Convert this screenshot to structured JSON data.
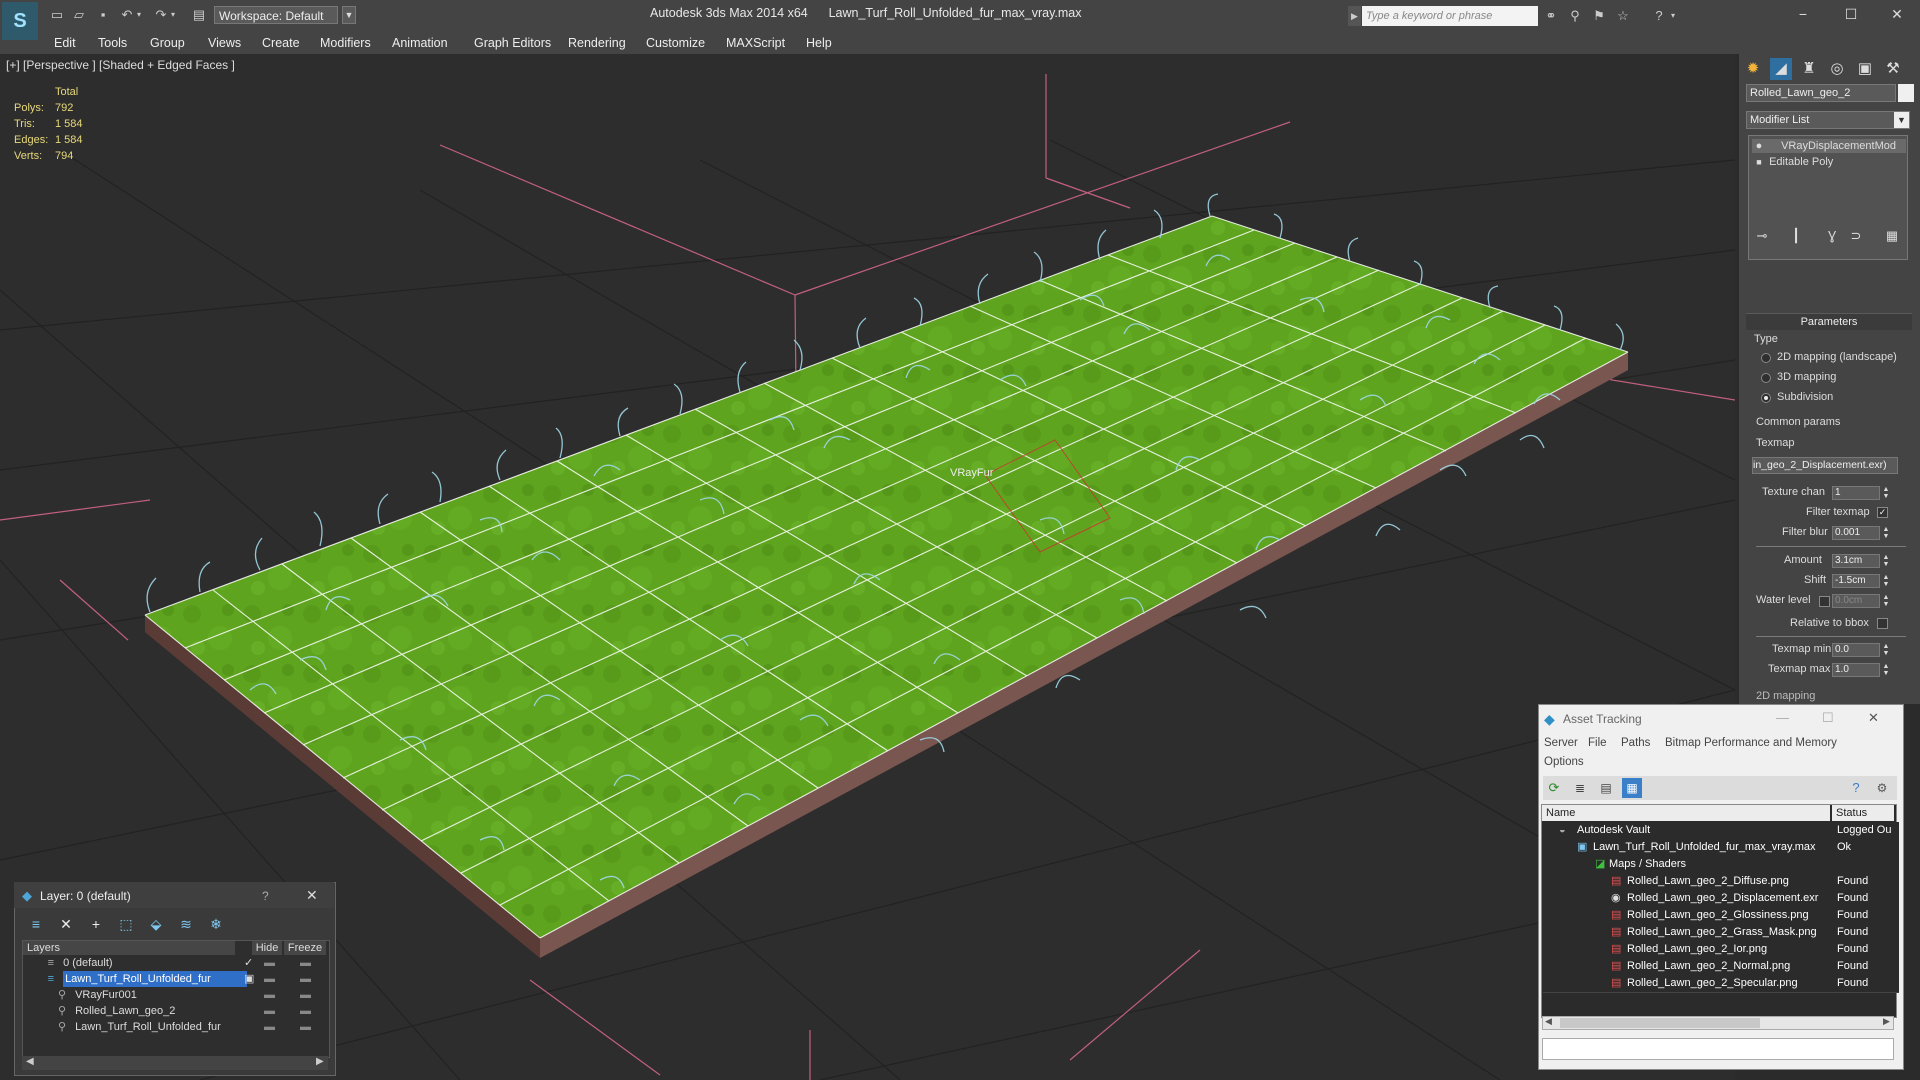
{
  "titlebar": {
    "workspace": "Workspace: Default",
    "app_name": "Autodesk 3ds Max  2014 x64",
    "file_name": "Lawn_Turf_Roll_Unfolded_fur_max_vray.max",
    "search_placeholder": "Type a keyword or phrase"
  },
  "menu": [
    "Edit",
    "Tools",
    "Group",
    "Views",
    "Create",
    "Modifiers",
    "Animation",
    "Graph Editors",
    "Rendering",
    "Customize",
    "MAXScript",
    "Help"
  ],
  "viewport": {
    "label": "[+] [Perspective ] [Shaded + Edged Faces ]",
    "stats_header": "Total",
    "stats": [
      {
        "label": "Polys:",
        "value": "792"
      },
      {
        "label": "Tris:",
        "value": "1 584"
      },
      {
        "label": "Edges:",
        "value": "1 584"
      },
      {
        "label": "Verts:",
        "value": "794"
      }
    ],
    "object_label": "VRayFur",
    "colors": {
      "grass": "#5fa41f",
      "wire": "#ffffff",
      "fur": "#9fd6e6",
      "ground_grid": "#1c1c1c",
      "axis": "#c2607e"
    }
  },
  "command_panel": {
    "object_name": "Rolled_Lawn_geo_2",
    "modifier_list": "Modifier List",
    "stack": [
      "VRayDisplacementMod",
      "Editable Poly"
    ],
    "parameters_title": "Parameters",
    "type_label": "Type",
    "type_options": [
      "2D mapping (landscape)",
      "3D mapping",
      "Subdivision"
    ],
    "type_selected": "Subdivision",
    "common_params": "Common params",
    "texmap_label": "Texmap",
    "texmap_value": "in_geo_2_Displacement.exr)",
    "texture_chan_label": "Texture chan",
    "texture_chan": "1",
    "filter_texmap_label": "Filter texmap",
    "filter_blur_label": "Filter blur",
    "filter_blur": "0.001",
    "amount_label": "Amount",
    "amount": "3.1cm",
    "shift_label": "Shift",
    "shift": "-1.5cm",
    "water_level_label": "Water level",
    "water_level": "0.0cm",
    "relative_bbox_label": "Relative to bbox",
    "texmap_min_label": "Texmap min",
    "texmap_min": "0.0",
    "texmap_max_label": "Texmap max",
    "texmap_max": "1.0",
    "next_rollout": "2D mapping"
  },
  "layer_explorer": {
    "title": "Layer: 0 (default)",
    "help": "?",
    "columns": [
      "Layers",
      "Hide",
      "Freeze"
    ],
    "rows": [
      {
        "name": "0 (default)",
        "indent": 0
      },
      {
        "name": "Lawn_Turf_Roll_Unfolded_fur",
        "indent": 0,
        "selected": true
      },
      {
        "name": "VRayFur001",
        "indent": 1
      },
      {
        "name": "Rolled_Lawn_geo_2",
        "indent": 1
      },
      {
        "name": "Lawn_Turf_Roll_Unfolded_fur",
        "indent": 1
      }
    ]
  },
  "asset_tracking": {
    "title": "Asset Tracking",
    "menu": [
      "Server",
      "File",
      "Paths",
      "Bitmap Performance and Memory",
      "Options"
    ],
    "columns": [
      "Name",
      "Status"
    ],
    "rows": [
      {
        "name": "Autodesk Vault",
        "status": "Logged Ou",
        "level": 0
      },
      {
        "name": "Lawn_Turf_Roll_Unfolded_fur_max_vray.max",
        "status": "Ok",
        "level": 1
      },
      {
        "name": "Maps / Shaders",
        "status": "",
        "level": 2
      },
      {
        "name": "Rolled_Lawn_geo_2_Diffuse.png",
        "status": "Found",
        "level": 3
      },
      {
        "name": "Rolled_Lawn_geo_2_Displacement.exr",
        "status": "Found",
        "level": 3
      },
      {
        "name": "Rolled_Lawn_geo_2_Glossiness.png",
        "status": "Found",
        "level": 3
      },
      {
        "name": "Rolled_Lawn_geo_2_Grass_Mask.png",
        "status": "Found",
        "level": 3
      },
      {
        "name": "Rolled_Lawn_geo_2_Ior.png",
        "status": "Found",
        "level": 3
      },
      {
        "name": "Rolled_Lawn_geo_2_Normal.png",
        "status": "Found",
        "level": 3
      },
      {
        "name": "Rolled_Lawn_geo_2_Specular.png",
        "status": "Found",
        "level": 3
      }
    ]
  }
}
